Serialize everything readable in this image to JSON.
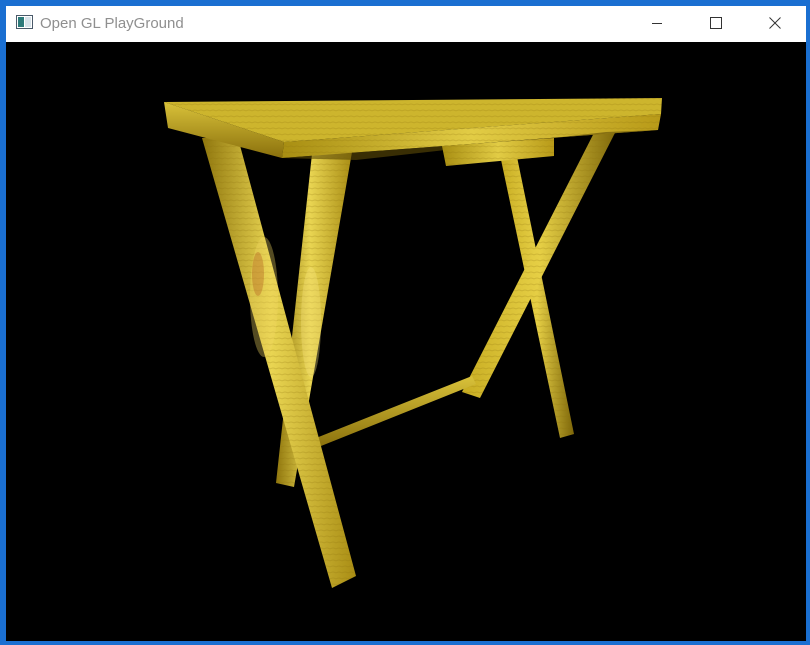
{
  "window": {
    "title": "Open GL PlayGround",
    "app_icon": "window-app-icon",
    "controls": {
      "minimize_icon": "minimize-icon",
      "maximize_icon": "maximize-icon",
      "close_icon": "close-icon"
    }
  },
  "colors": {
    "frame_accent": "#1a6fd1",
    "titlebar_bg": "#ffffff",
    "title_text": "#8f8f8f",
    "viewport_bg": "#000000",
    "wood_light": "#e8d24a",
    "wood_mid": "#c9ad1f",
    "wood_dark": "#6e5a08"
  },
  "scene": {
    "subject": "3D wooden folding table",
    "parts": [
      "tabletop",
      "drawer",
      "front-left-leg",
      "front-right-leg",
      "back-left-leg",
      "back-right-leg",
      "cross-bar"
    ]
  }
}
